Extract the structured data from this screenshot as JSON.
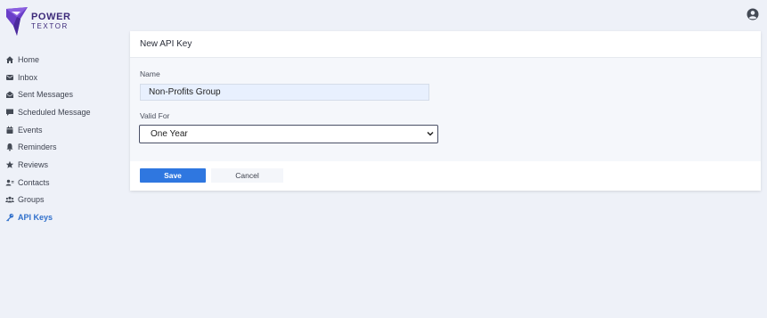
{
  "brand": {
    "name_line1": "POWER",
    "name_line2": "TEXTOR"
  },
  "header": {
    "user_icon": "user-circle-icon"
  },
  "sidebar": {
    "items": [
      {
        "label": "Home",
        "icon": "home-icon"
      },
      {
        "label": "Inbox",
        "icon": "inbox-icon"
      },
      {
        "label": "Sent Messages",
        "icon": "sent-icon"
      },
      {
        "label": "Scheduled Message",
        "icon": "scheduled-icon"
      },
      {
        "label": "Events",
        "icon": "calendar-icon"
      },
      {
        "label": "Reminders",
        "icon": "bell-icon"
      },
      {
        "label": "Reviews",
        "icon": "star-icon"
      },
      {
        "label": "Contacts",
        "icon": "contacts-icon"
      },
      {
        "label": "Groups",
        "icon": "groups-icon"
      },
      {
        "label": "API Keys",
        "icon": "key-icon",
        "active": true
      }
    ]
  },
  "form": {
    "title": "New API Key",
    "name_label": "Name",
    "name_value": "Non-Profits Group",
    "valid_for_label": "Valid For",
    "valid_for_value": "One Year",
    "save_label": "Save",
    "cancel_label": "Cancel"
  },
  "colors": {
    "accent": "#2f77e0",
    "active_nav": "#2f6fcb",
    "brand": "#6a3fc8",
    "background": "#eef1f8"
  }
}
